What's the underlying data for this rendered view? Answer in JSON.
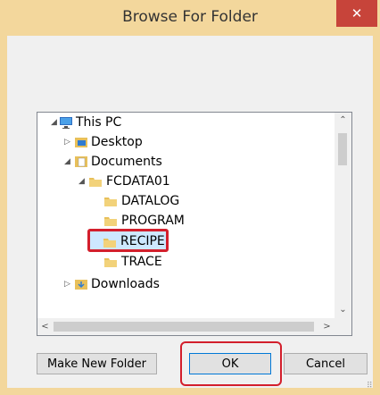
{
  "window": {
    "title": "Browse For Folder",
    "close_glyph": "✕"
  },
  "tree": {
    "items": [
      {
        "label": "This PC",
        "icon": "computer-icon",
        "arrow": "◢"
      },
      {
        "label": "Desktop",
        "icon": "folder-icon",
        "arrow": "▷"
      },
      {
        "label": "Documents",
        "icon": "folder-icon",
        "arrow": "◢"
      },
      {
        "label": "FCDATA01",
        "icon": "folder-icon",
        "arrow": "◢"
      },
      {
        "label": "DATALOG",
        "icon": "folder-icon"
      },
      {
        "label": "PROGRAM",
        "icon": "folder-icon"
      },
      {
        "label": "RECIPE",
        "icon": "folder-icon",
        "selected": true
      },
      {
        "label": "TRACE",
        "icon": "folder-icon"
      },
      {
        "label": "Downloads",
        "icon": "folder-icon",
        "arrow": "▷"
      }
    ],
    "scroll_up": "⌃",
    "scroll_down": "⌄",
    "scroll_left": "<",
    "scroll_right": ">"
  },
  "buttons": {
    "make_new_folder": "Make New Folder",
    "ok": "OK",
    "cancel": "Cancel"
  },
  "colors": {
    "titlebar": "#f3d79c",
    "close": "#c7443a",
    "highlight": "#d31f2c"
  }
}
